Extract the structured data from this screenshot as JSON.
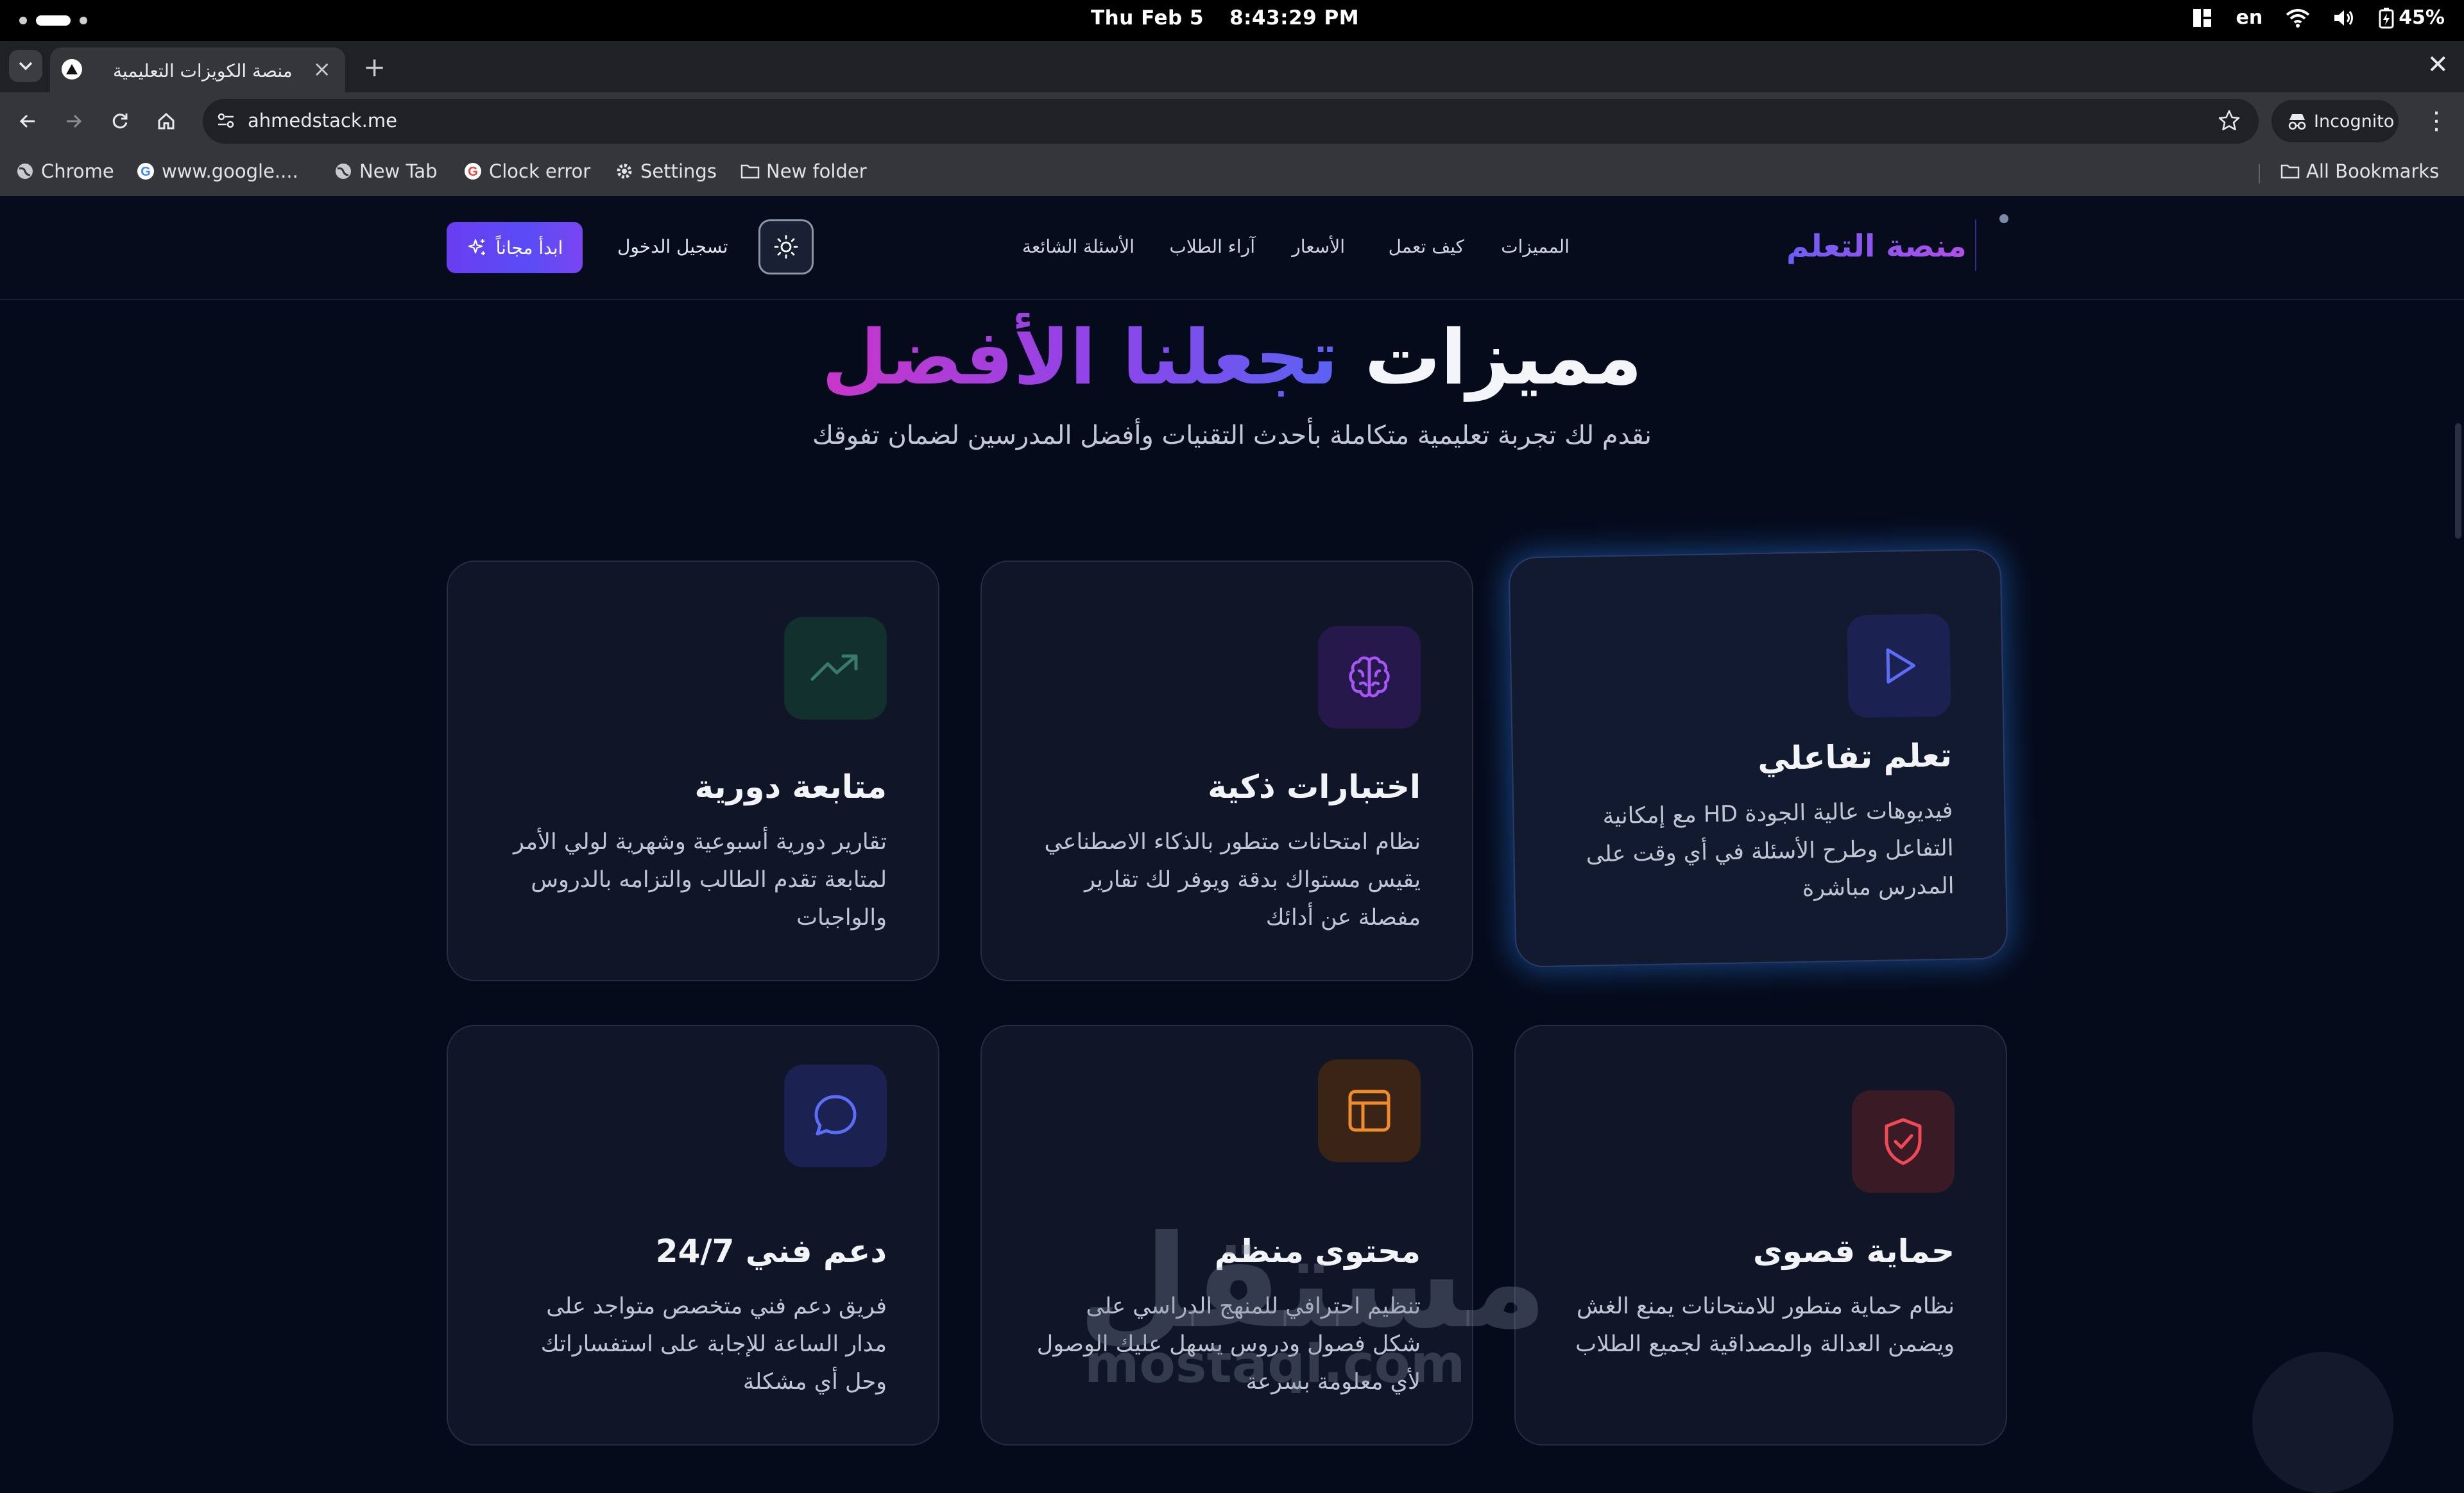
{
  "os": {
    "date": "Thu Feb 5",
    "time": "8:43:29 PM",
    "lang": "en",
    "battery": "45%"
  },
  "browser": {
    "tab_title": "منصة الكويزات التعليمية",
    "url": "ahmedstack.me",
    "incognito_label": "Incognito",
    "bookmarks": [
      {
        "label": "Chrome",
        "icon": "globe-icon"
      },
      {
        "label": "www.google....",
        "icon": "google-icon"
      },
      {
        "label": "New Tab",
        "icon": "globe-icon"
      },
      {
        "label": "Clock error",
        "icon": "google-icon"
      },
      {
        "label": "Settings",
        "icon": "gear-icon"
      },
      {
        "label": "New folder",
        "icon": "folder-icon"
      }
    ],
    "all_bookmarks": "All Bookmarks"
  },
  "site": {
    "logo": "منصة التعلم",
    "nav": [
      "المميزات",
      "كيف تعمل",
      "الأسعار",
      "آراء الطلاب",
      "الأسئلة الشائعة"
    ],
    "login": "تسجيل الدخول",
    "cta": "ابدأ مجاناً"
  },
  "section": {
    "title_plain": "مميزات",
    "title_gradient": "تجعلنا الأفضل",
    "subtitle": "نقدم لك تجربة تعليمية متكاملة بأحدث التقنيات وأفضل المدرسين لضمان تفوقك"
  },
  "features": [
    {
      "title": "تعلم تفاعلي",
      "desc": "فيديوهات عالية الجودة HD مع إمكانية التفاعل وطرح الأسئلة في أي وقت على المدرس مباشرة",
      "icon": "play-icon",
      "color": "#5b6cf5"
    },
    {
      "title": "اختبارات ذكية",
      "desc": "نظام امتحانات متطور بالذكاء الاصطناعي يقيس مستواك بدقة ويوفر لك تقارير مفصلة عن أدائك",
      "icon": "brain-icon",
      "color": "#a855f7"
    },
    {
      "title": "متابعة دورية",
      "desc": "تقارير دورية أسبوعية وشهرية لولي الأمر لمتابعة تقدم الطالب والتزامه بالدروس والواجبات",
      "icon": "trending-up-icon",
      "color": "#22c39a"
    },
    {
      "title": "حماية قصوى",
      "desc": "نظام حماية متطور للامتحانات يمنع الغش ويضمن العدالة والمصداقية لجميع الطلاب",
      "icon": "shield-check-icon",
      "color": "#ef4a55"
    },
    {
      "title": "محتوى منظم",
      "desc": "تنظيم احترافي للمنهج الدراسي على شكل فصول ودروس يسهل عليك الوصول لأي معلومة بسرعة",
      "icon": "layout-icon",
      "color": "#f28a2e"
    },
    {
      "title": "دعم فني 24/7",
      "desc": "فريق دعم فني متخصص متواجد على مدار الساعة للإجابة على استفساراتك وحل أي مشكلة",
      "icon": "chat-bubble-icon",
      "color": "#5b6cf5"
    }
  ],
  "watermark": {
    "arabic": "مستقل",
    "latin": "mostaql.com"
  }
}
